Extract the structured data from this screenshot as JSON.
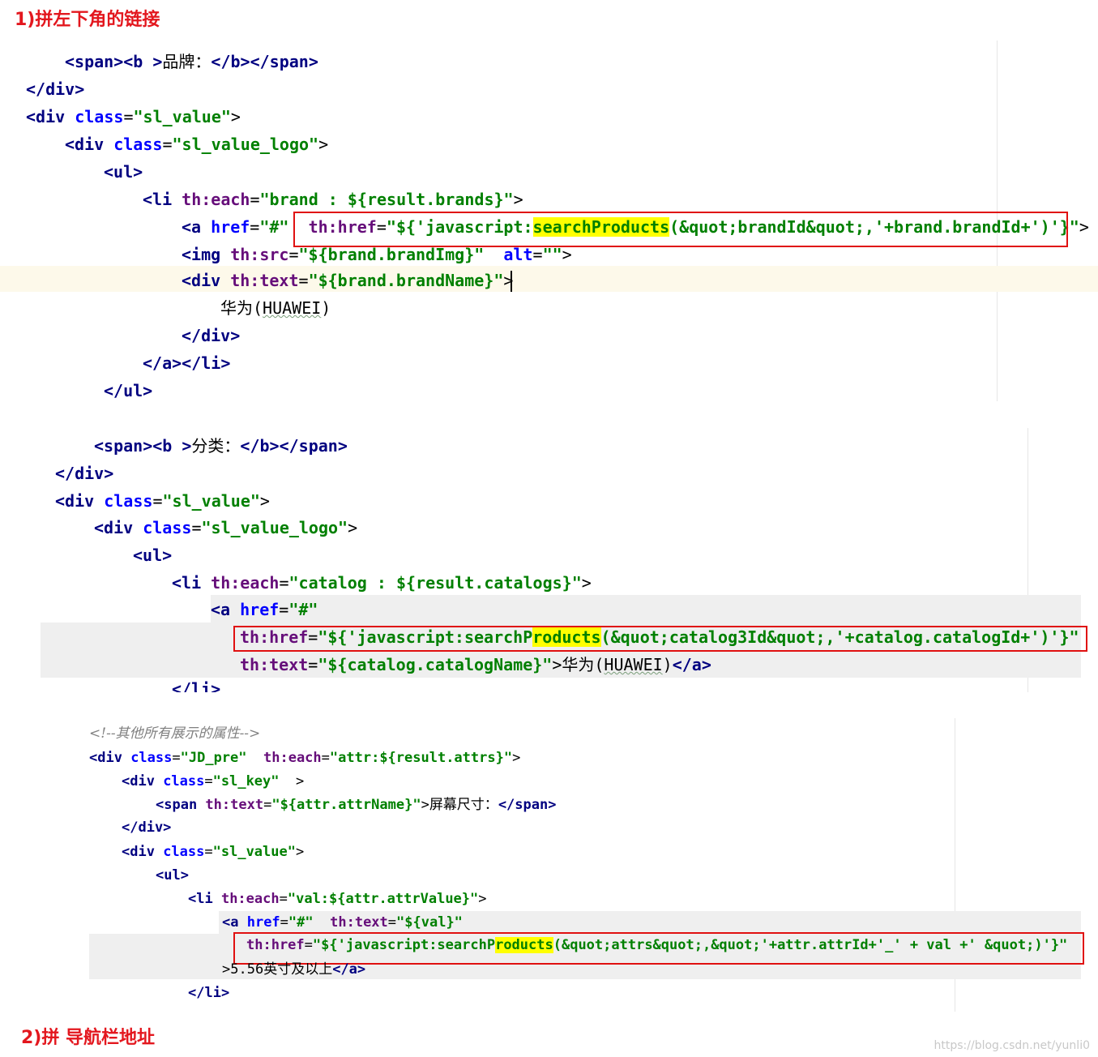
{
  "captions": {
    "c1": "1)拼左下角的链接",
    "c2": "2)拼 导航栏地址"
  },
  "watermark": "https://blog.csdn.net/yunli0",
  "block1": {
    "l1_open": "<span><b >",
    "l1_text": "品牌：",
    "l1_close": "</b></span>",
    "l2": "</div>",
    "l3_tag": "<div ",
    "l3_attr": "class",
    "l3_eq": "=",
    "l3_val": "\"sl_value\"",
    "l3_end": ">",
    "l4_tag": "<div ",
    "l4_attr": "class",
    "l4_eq": "=",
    "l4_val": "\"sl_value_logo\"",
    "l4_end": ">",
    "l5": "<ul>",
    "l6_tag": "<li ",
    "l6_attr": "th:each",
    "l6_eq": "=",
    "l6_val": "\"brand : ${result.brands}\"",
    "l6_end": ">",
    "l7_tag": "<a ",
    "l7_attr": "href",
    "l7_eq": "=",
    "l7_val": "\"#\" ",
    "l7_thattr": "th:href",
    "l7_theq": "=",
    "l7_v1": "\"${'javascript:",
    "l7_hl": "searchProducts",
    "l7_v2": "(&quot;brandId&quot;,'+brand.brandId+')'}\"",
    "l7_end": ">",
    "l8_tag": "<img ",
    "l8_attr": "th:src",
    "l8_eq": "=",
    "l8_val": "\"${brand.brandImg}\" ",
    "l8_attr2": "alt",
    "l8_eq2": "=",
    "l8_val2": "\"\"",
    "l8_end": ">",
    "l9_tag": "<div ",
    "l9_attr": "th:text",
    "l9_eq": "=",
    "l9_val": "\"${brand.brandName}\"",
    "l9_end": ">",
    "l10_a": "华为(",
    "l10_b": "HUAWEI",
    "l10_c": ")",
    "l11": "</div>",
    "l12": "</a></li>",
    "l13": "</ul>"
  },
  "block2": {
    "l1_open": "<span><b >",
    "l1_text": "分类：",
    "l1_close": "</b></span>",
    "l2": "</div>",
    "l3_tag": "<div ",
    "l3_attr": "class",
    "l3_eq": "=",
    "l3_val": "\"sl_value\"",
    "l3_end": ">",
    "l4_tag": "<div ",
    "l4_attr": "class",
    "l4_eq": "=",
    "l4_val": "\"sl_value_logo\"",
    "l4_end": ">",
    "l5": "<ul>",
    "l6_tag": "<li ",
    "l6_attr": "th:each",
    "l6_eq": "=",
    "l6_val": "\"catalog : ${result.catalogs}\"",
    "l6_end": ">",
    "l7_tag": "<a ",
    "l7_attr": "href",
    "l7_eq": "=",
    "l7_val": "\"#\"",
    "l8_attr": "th:href",
    "l8_eq": "=",
    "l8_v1": "\"${'javascript:searchP",
    "l8_hl": "roducts",
    "l8_v2": "(&quot;catalog3Id&quot;,'+catalog.catalogId+')'}\"",
    "l9_attr": "th:text",
    "l9_eq": "=",
    "l9_val": "\"${catalog.catalogName}\"",
    "l9_gt": ">",
    "l9_t1": "华为(",
    "l9_t2": "HUAWEI",
    "l9_t3": ")",
    "l9_close": "</a>",
    "l10": "</li>"
  },
  "block3": {
    "l1": "<!--其他所有展示的属性-->",
    "l2_tag": "<div ",
    "l2_attr": "class",
    "l2_eq": "=",
    "l2_val": "\"JD_pre\" ",
    "l2_attr2": "th:each",
    "l2_eq2": "=",
    "l2_val2": "\"attr:${result.attrs}\"",
    "l2_end": ">",
    "l3_tag": "<div ",
    "l3_attr": "class",
    "l3_eq": "=",
    "l3_val": "\"sl_key\" ",
    "l3_end": ">",
    "l4_tag": "<span ",
    "l4_attr": "th:text",
    "l4_eq": "=",
    "l4_val": "\"${attr.attrName}\"",
    "l4_gt": ">",
    "l4_text": "屏幕尺寸：",
    "l4_close": "</span>",
    "l5": "</div>",
    "l6_tag": "<div ",
    "l6_attr": "class",
    "l6_eq": "=",
    "l6_val": "\"sl_value\"",
    "l6_end": ">",
    "l7": "<ul>",
    "l8_tag": "<li ",
    "l8_attr": "th:each",
    "l8_eq": "=",
    "l8_val": "\"val:${attr.attrValue}\"",
    "l8_end": ">",
    "l9_tag": "<a ",
    "l9_attr": "href",
    "l9_eq": "=",
    "l9_val": "\"#\" ",
    "l9_attr2": "th:text",
    "l9_eq2": "=",
    "l9_val2": "\"${val}\"",
    "l10_attr": "th:href",
    "l10_eq": "=",
    "l10_v1": "\"${'javascript:searchP",
    "l10_hl": "roducts",
    "l10_v2": "(&quot;attrs&quot;,&quot;'+attr.attrId+'_' + val +' &quot;)'}\"",
    "l11_gt": ">",
    "l11_text": "5.56英寸及以上",
    "l11_close": "</a>",
    "l12": "</li>"
  }
}
